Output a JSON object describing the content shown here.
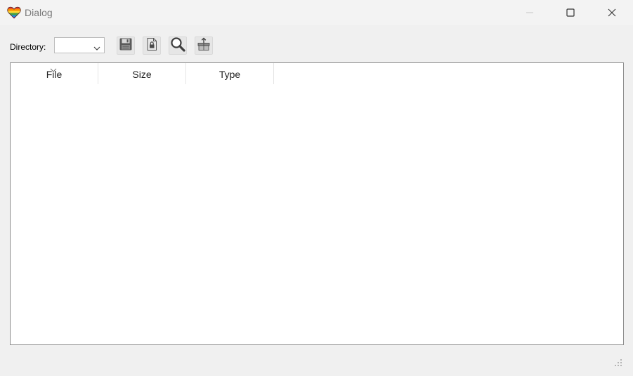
{
  "window": {
    "title": "Dialog",
    "app_icon": "rainbow-heart-icon",
    "controls": [
      "minimize-icon",
      "maximize-icon",
      "close-icon"
    ]
  },
  "toolbar": {
    "directory_label": "Directory:",
    "directory_value": "",
    "buttons": [
      {
        "icon": "floppy-save-icon"
      },
      {
        "icon": "locked-file-icon"
      },
      {
        "icon": "magnifier-search-icon"
      },
      {
        "icon": "box-upload-icon"
      }
    ]
  },
  "file_list": {
    "columns": [
      {
        "label": "File",
        "sorted": "descending"
      },
      {
        "label": "Size"
      },
      {
        "label": "Type"
      }
    ],
    "rows": []
  }
}
